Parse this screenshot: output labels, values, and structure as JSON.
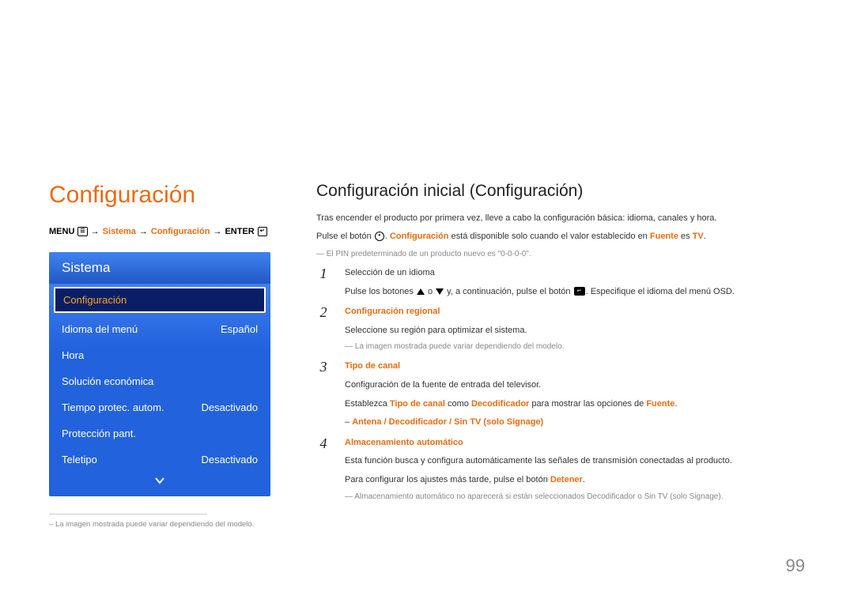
{
  "section_title": "Configuración",
  "breadcrumb": {
    "menu": "MENU",
    "sistema": "Sistema",
    "config": "Configuración",
    "enter": "ENTER"
  },
  "osd": {
    "header": "Sistema",
    "items": [
      {
        "label": "Configuración",
        "value": "",
        "selected": true
      },
      {
        "label": "Idioma del menú",
        "value": "Español",
        "selected": false
      },
      {
        "label": "Hora",
        "value": "",
        "selected": false
      },
      {
        "label": "Solución económica",
        "value": "",
        "selected": false
      },
      {
        "label": "Tiempo protec. autom.",
        "value": "Desactivado",
        "selected": false
      },
      {
        "label": "Protección pant.",
        "value": "",
        "selected": false
      },
      {
        "label": "Teletipo",
        "value": "Desactivado",
        "selected": false
      }
    ]
  },
  "left_note": "La imagen mostrada puede variar dependiendo del modelo.",
  "right": {
    "title": "Configuración inicial (Configuración)",
    "intro1": "Tras encender el producto por primera vez, lleve a cabo la configuración básica: idioma, canales y hora.",
    "intro2_a": "Pulse el botón ",
    "intro2_b": ". ",
    "intro2_c": "Configuración",
    "intro2_d": " está disponible solo cuando el valor establecido en ",
    "intro2_e": "Fuente",
    "intro2_f": " es ",
    "intro2_g": "TV",
    "intro2_h": ".",
    "note_pin": "El PIN predeterminado de un producto nuevo es \"0-0-0-0\"."
  },
  "steps": [
    {
      "num": "1",
      "title": "Selección de un idioma",
      "body_a": "Pulse los botones ",
      "body_b": " o ",
      "body_c": " y, a continuación, pulse el botón ",
      "body_d": ". Especifique el idioma del menú OSD."
    },
    {
      "num": "2",
      "title": "Configuración regional",
      "body": "Seleccione su región para optimizar el sistema.",
      "note": "La imagen mostrada puede variar dependiendo del modelo."
    },
    {
      "num": "3",
      "title": "Tipo de canal",
      "body1": "Configuración de la fuente de entrada del televisor.",
      "body2_a": "Establezca ",
      "body2_b": "Tipo de canal",
      "body2_c": " como ",
      "body2_d": "Decodificador",
      "body2_e": " para mostrar las opciones de ",
      "body2_f": "Fuente",
      "body2_g": ".",
      "options": "Antena / Decodificador / Sin TV (solo Signage)"
    },
    {
      "num": "4",
      "title": "Almacenamiento automático",
      "body1": "Esta función busca y configura automáticamente las señales de transmisión conectadas al producto.",
      "body2_a": "Para configurar los ajustes más tarde, pulse el botón ",
      "body2_b": "Detener",
      "body2_c": ".",
      "note_a": "Almacenamiento automático",
      "note_b": " no aparecerá si están seleccionados ",
      "note_c": "Decodificador",
      "note_d": " o ",
      "note_e": "Sin TV (solo Signage)",
      "note_f": "."
    }
  ],
  "page_number": "99"
}
